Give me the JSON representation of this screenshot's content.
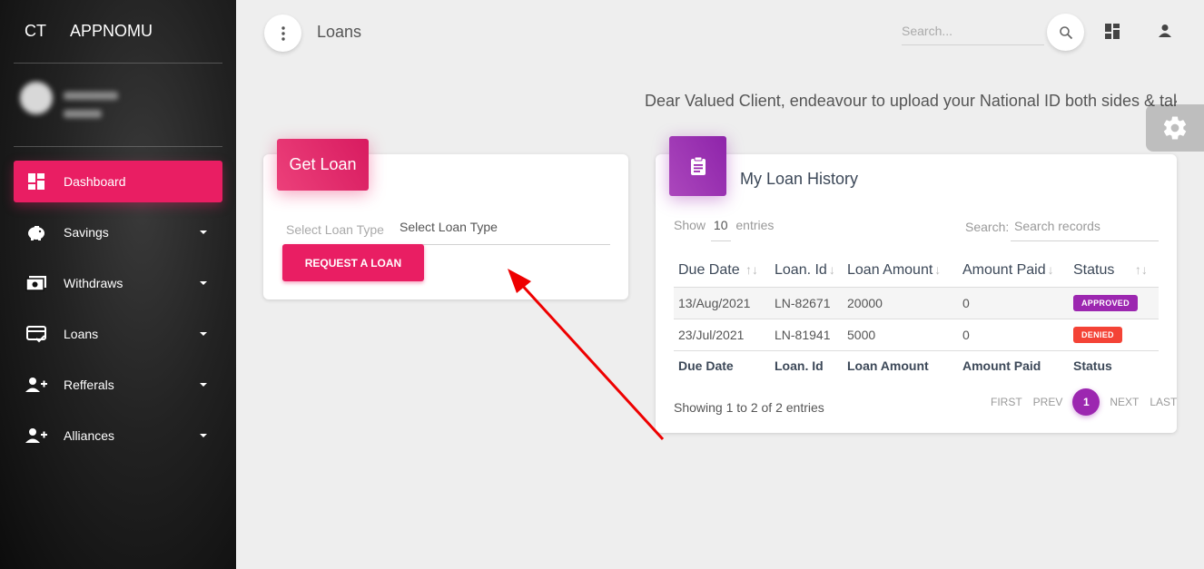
{
  "brand": {
    "mini": "CT",
    "name": "APPNOMU"
  },
  "sidebar": {
    "items": [
      {
        "label": "Dashboard",
        "icon": "dashboard-icon",
        "active": true
      },
      {
        "label": "Savings",
        "icon": "piggy-bank-icon"
      },
      {
        "label": "Withdraws",
        "icon": "money-icon"
      },
      {
        "label": "Loans",
        "icon": "card-check-icon"
      },
      {
        "label": "Refferals",
        "icon": "person-add-icon"
      },
      {
        "label": "Alliances",
        "icon": "person-add-icon"
      }
    ]
  },
  "header": {
    "title": "Loans",
    "search_placeholder": "Search..."
  },
  "notice": "Dear Valued Client, endeavour to upload your National ID both sides & takin",
  "get_loan": {
    "title": "Get Loan",
    "select_label": "Select Loan Type",
    "select_value": "Select Loan Type",
    "button": "REQUEST A LOAN"
  },
  "history": {
    "title": "My Loan History",
    "show_prefix": "Show",
    "show_count": "10",
    "show_suffix": "entries",
    "search_label": "Search:",
    "search_placeholder": "Search records",
    "columns": [
      "Due Date",
      "Loan. Id",
      "Loan Amount",
      "Amount Paid",
      "Status"
    ],
    "rows": [
      {
        "due_date": "13/Aug/2021",
        "loan_id": "LN-82671",
        "amount": "20000",
        "paid": "0",
        "status": "APPROVED",
        "status_color": "#9c27b0"
      },
      {
        "due_date": "23/Jul/2021",
        "loan_id": "LN-81941",
        "amount": "5000",
        "paid": "0",
        "status": "DENIED",
        "status_color": "#f44336"
      }
    ],
    "footer": [
      "Due Date",
      "Loan. Id",
      "Loan Amount",
      "Amount Paid",
      "Status"
    ],
    "info": "Showing 1 to 2 of 2 entries",
    "pagination": {
      "first": "FIRST",
      "prev": "PREV",
      "current": "1",
      "next": "NEXT",
      "last": "LAST"
    }
  },
  "colors": {
    "primary": "#e91e63",
    "purple": "#9c27b0",
    "annotation_arrow": "#ee0000"
  }
}
